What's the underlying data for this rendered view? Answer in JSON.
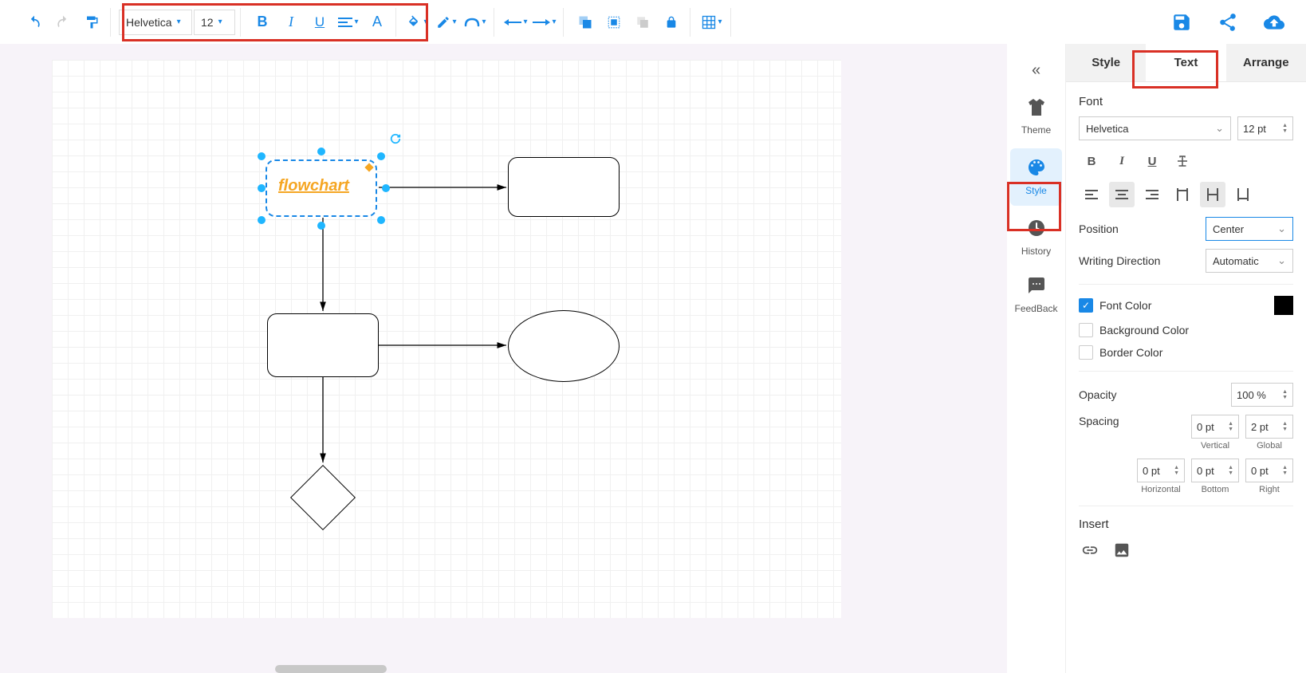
{
  "toolbar": {
    "font_family": "Helvetica",
    "font_size": "12"
  },
  "canvas": {
    "selected_shape_text": "flowchart"
  },
  "vsidebar": {
    "theme": "Theme",
    "style": "Style",
    "history": "History",
    "feedback": "FeedBack"
  },
  "rpanel": {
    "tabs": {
      "style": "Style",
      "text": "Text",
      "arrange": "Arrange"
    },
    "font": {
      "title": "Font",
      "family": "Helvetica",
      "size": "12 pt"
    },
    "position": {
      "label": "Position",
      "value": "Center"
    },
    "writing_direction": {
      "label": "Writing Direction",
      "value": "Automatic"
    },
    "font_color": {
      "label": "Font Color"
    },
    "background_color": {
      "label": "Background Color"
    },
    "border_color": {
      "label": "Border Color"
    },
    "opacity": {
      "label": "Opacity",
      "value": "100 %"
    },
    "spacing": {
      "label": "Spacing",
      "vertical": {
        "value": "0 pt",
        "label": "Vertical"
      },
      "global": {
        "value": "2 pt",
        "label": "Global"
      },
      "horizontal": {
        "value": "0 pt",
        "label": "Horizontal"
      },
      "bottom": {
        "value": "0 pt",
        "label": "Bottom"
      },
      "right": {
        "value": "0 pt",
        "label": "Right"
      }
    },
    "insert": {
      "label": "Insert"
    }
  }
}
